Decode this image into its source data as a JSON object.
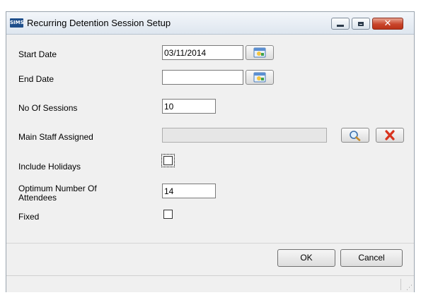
{
  "window": {
    "title": "Recurring Detention Session Setup",
    "app_icon_text": "SIMS",
    "controls": [
      "minimize-icon",
      "maximize-icon",
      "close-icon"
    ]
  },
  "form": {
    "start_date": {
      "label": "Start Date",
      "value": "03/11/2014",
      "button_icon": "calendar-icon"
    },
    "end_date": {
      "label": "End Date",
      "value": "",
      "button_icon": "calendar-icon"
    },
    "no_of_sessions": {
      "label": "No Of Sessions",
      "value": "10"
    },
    "main_staff": {
      "label": "Main Staff Assigned",
      "value": "",
      "search_icon": "magnifier-icon",
      "clear_icon": "red-x-icon"
    },
    "include_holidays": {
      "label": "Include Holidays",
      "checked": false
    },
    "optimum_attendees": {
      "label": "Optimum Number Of Attendees",
      "value": "14"
    },
    "fixed": {
      "label": "Fixed",
      "checked": false
    }
  },
  "buttons": {
    "ok": "OK",
    "cancel": "Cancel"
  },
  "colors": {
    "title_bar": "#dee6ef",
    "close_button": "#c9452c",
    "dialog_bg": "#f0f0f0"
  }
}
